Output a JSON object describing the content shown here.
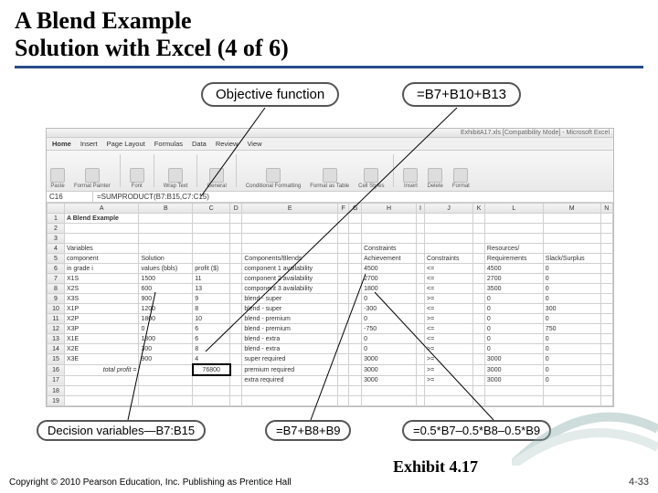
{
  "title_line1": "A Blend Example",
  "title_line2": "Solution with Excel (4 of 6)",
  "callouts": {
    "obj_fn": "Objective function",
    "obj_formula": "=B7+B10+B13",
    "dec_vars": "Decision variables—B7:B15",
    "f1": "=B7+B8+B9",
    "f2": "=0.5*B7–0.5*B8–0.5*B9"
  },
  "excel": {
    "win_title": "ExhibitA17.xls [Compatibility Mode] - Microsoft Excel",
    "tabs": [
      "Home",
      "Insert",
      "Page Layout",
      "Formulas",
      "Data",
      "Review",
      "View"
    ],
    "ribbon_groups": [
      "Paste",
      "Font",
      "Format Painter",
      "Wrap Text",
      "General",
      "Conditional Formatting",
      "Format as Table",
      "Cell Styles",
      "Insert",
      "Delete",
      "Format"
    ],
    "name_box": "C16",
    "formula": "=SUMPRODUCT(B7:B15,C7:C15)",
    "cols": [
      "",
      "A",
      "B",
      "C",
      "D",
      "E",
      "F",
      "G",
      "H",
      "I",
      "J",
      "K",
      "L",
      "M",
      "N"
    ],
    "rows": [
      {
        "n": "1",
        "A_bold": "A Blend Example"
      },
      {
        "n": "2"
      },
      {
        "n": "3"
      },
      {
        "n": "4",
        "A": "Variables",
        "H": "Constraints",
        "L": "Resources/"
      },
      {
        "n": "5",
        "A": "component",
        "B": "Solution",
        "E": "Components/Blends",
        "H": "Achievement",
        "J": "Constraints",
        "L": "Requirements",
        "M": "Slack/Surplus"
      },
      {
        "n": "6",
        "A": "in grade i",
        "B": "values (bbls)",
        "C": "profit ($)",
        "E": "component 1 availability",
        "H": "4500",
        "J": "<=",
        "L": "4500",
        "M": "0"
      },
      {
        "n": "7",
        "A": "X1S",
        "B": "1500",
        "C": "11",
        "E": "component 2 availability",
        "H": "2700",
        "J": "<=",
        "L": "2700",
        "M": "0"
      },
      {
        "n": "8",
        "A": "X2S",
        "B": "600",
        "C": "13",
        "E": "component 3 availability",
        "H": "1800",
        "J": "<=",
        "L": "3500",
        "M": "0"
      },
      {
        "n": "9",
        "A": "X3S",
        "B": "900",
        "C": "9",
        "E": "blend - super",
        "H": "0",
        "J": ">=",
        "L": "0",
        "M": "0"
      },
      {
        "n": "10",
        "A": "X1P",
        "B": "1200",
        "C": "8",
        "E": "blend - super",
        "H": "-300",
        "J": "<=",
        "L": "0",
        "M": "300"
      },
      {
        "n": "11",
        "A": "X2P",
        "B": "1800",
        "C": "10",
        "E": "blend - premium",
        "H": "0",
        "J": ">=",
        "L": "0",
        "M": "0"
      },
      {
        "n": "12",
        "A": "X3P",
        "B": "0",
        "C": "6",
        "E": "blend - premium",
        "H": "-750",
        "J": "<=",
        "L": "0",
        "M": "750"
      },
      {
        "n": "13",
        "A": "X1E",
        "B": "1800",
        "C": "6",
        "E": "blend - extra",
        "H": "0",
        "J": "<=",
        "L": "0",
        "M": "0"
      },
      {
        "n": "14",
        "A": "X2E",
        "B": "300",
        "C": "8",
        "E": "blend - extra",
        "H": "0",
        "J": ">=",
        "L": "0",
        "M": "0"
      },
      {
        "n": "15",
        "A": "X3E",
        "B": "900",
        "C": "4",
        "E": "super required",
        "H": "3000",
        "J": ">=",
        "L": "3000",
        "M": "0"
      },
      {
        "n": "16",
        "A": "total profit =",
        "C": "76800",
        "E": "premium required",
        "H": "3000",
        "J": ">=",
        "L": "3000",
        "M": "0"
      },
      {
        "n": "17",
        "E": "extra required",
        "H": "3000",
        "J": ">=",
        "L": "3000",
        "M": "0"
      },
      {
        "n": "18"
      },
      {
        "n": "19"
      }
    ]
  },
  "footer": {
    "copyright": "Copyright © 2010 Pearson Education, Inc. Publishing as Prentice Hall",
    "exhibit": "Exhibit 4.17",
    "page": "4-33"
  }
}
